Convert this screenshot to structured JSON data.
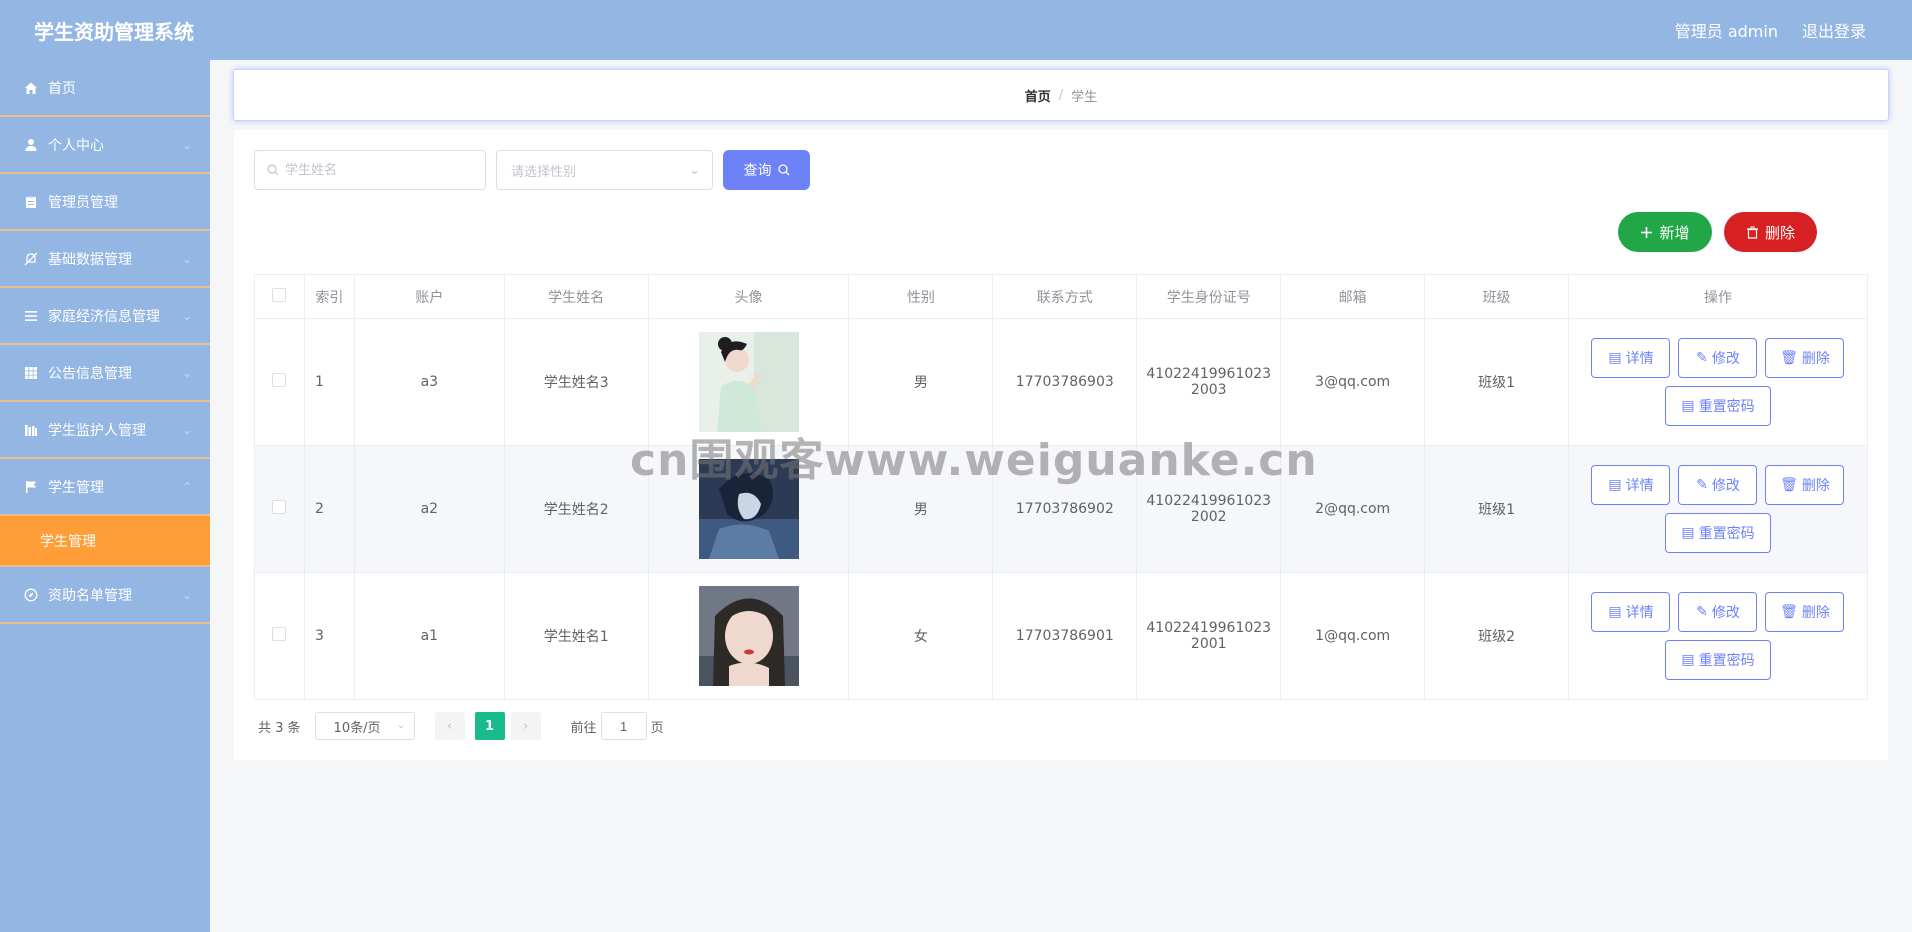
{
  "app": {
    "title": "学生资助管理系统"
  },
  "header": {
    "admin_label": "管理员 admin",
    "logout_label": "退出登录"
  },
  "sidebar": {
    "items": [
      {
        "label": "首页",
        "icon": "home-icon"
      },
      {
        "label": "个人中心",
        "icon": "user-icon"
      },
      {
        "label": "管理员管理",
        "icon": "clipboard-icon"
      },
      {
        "label": "基础数据管理",
        "icon": "bell-off-icon"
      },
      {
        "label": "家庭经济信息管理",
        "icon": "list-icon"
      },
      {
        "label": "公告信息管理",
        "icon": "grid-icon"
      },
      {
        "label": "学生监护人管理",
        "icon": "library-icon"
      },
      {
        "label": "学生管理",
        "icon": "flag-icon"
      },
      {
        "label": "资助名单管理",
        "icon": "compass-icon"
      }
    ],
    "sub_item": "学生管理"
  },
  "breadcrumb": {
    "home": "首页",
    "separator": "/",
    "current": "学生"
  },
  "search": {
    "name_placeholder": "学生姓名",
    "gender_placeholder": "请选择性别",
    "query_label": "查询"
  },
  "actions": {
    "add_label": "新增",
    "delete_label": "删除"
  },
  "table": {
    "headers": [
      "索引",
      "账户",
      "学生姓名",
      "头像",
      "性别",
      "联系方式",
      "学生身份证号",
      "邮箱",
      "班级",
      "操作"
    ],
    "rows": [
      {
        "index": "1",
        "account": "a3",
        "name": "学生姓名3",
        "gender": "男",
        "phone": "17703786903",
        "id_line1": "41022419961023",
        "id_line2": "2003",
        "email": "3@qq.com",
        "class": "班级1"
      },
      {
        "index": "2",
        "account": "a2",
        "name": "学生姓名2",
        "gender": "男",
        "phone": "17703786902",
        "id_line1": "41022419961023",
        "id_line2": "2002",
        "email": "2@qq.com",
        "class": "班级1"
      },
      {
        "index": "3",
        "account": "a1",
        "name": "学生姓名1",
        "gender": "女",
        "phone": "17703786901",
        "id_line1": "41022419961023",
        "id_line2": "2001",
        "email": "1@qq.com",
        "class": "班级2"
      }
    ],
    "op_labels": {
      "detail": "详情",
      "edit": "修改",
      "delete": "删除",
      "reset": "重置密码"
    }
  },
  "pagination": {
    "total": "共 3 条",
    "page_size": "10条/页",
    "current_page": "1",
    "goto_prefix": "前往",
    "goto_value": "1",
    "goto_suffix": "页"
  },
  "watermark": "cn围观客www.weiguanke.cn",
  "colors": {
    "header": "#93b6e3",
    "active_menu": "#ff9d36",
    "primary": "#6d82f9",
    "add": "#22a748",
    "danger": "#d62022",
    "page_active": "#18bc8c"
  }
}
